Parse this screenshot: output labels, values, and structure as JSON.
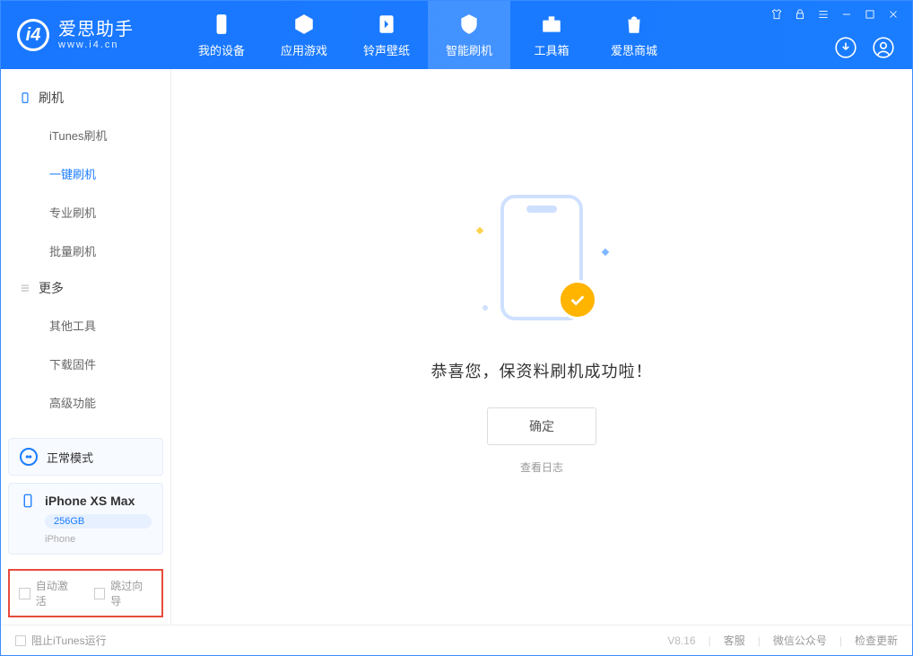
{
  "brand": {
    "name": "爱思助手",
    "site": "www.i4.cn",
    "logo_letter": "i4"
  },
  "nav": {
    "device": "我的设备",
    "apps": "应用游戏",
    "ring": "铃声壁纸",
    "flash": "智能刷机",
    "tools": "工具箱",
    "store": "爱思商城"
  },
  "sidebar": {
    "group_flash": "刷机",
    "items_flash": {
      "itunes": "iTunes刷机",
      "oneclick": "一键刷机",
      "pro": "专业刷机",
      "batch": "批量刷机"
    },
    "group_more": "更多",
    "items_more": {
      "other": "其他工具",
      "firmware": "下载固件",
      "advanced": "高级功能"
    }
  },
  "device": {
    "mode": "正常模式",
    "name": "iPhone XS Max",
    "storage": "256GB",
    "type": "iPhone"
  },
  "options": {
    "auto_activate": "自动激活",
    "skip_guide": "跳过向导"
  },
  "main": {
    "success": "恭喜您，保资料刷机成功啦！",
    "ok": "确定",
    "view_log": "查看日志"
  },
  "footer": {
    "block_itunes": "阻止iTunes运行",
    "version": "V8.16",
    "support": "客服",
    "wechat": "微信公众号",
    "update": "检查更新"
  }
}
